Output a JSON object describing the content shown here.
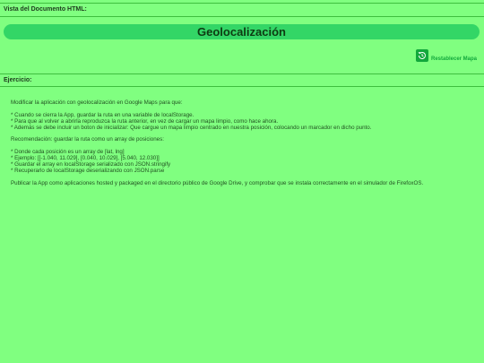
{
  "header": {
    "doc_view_label": "Vista del Documento HTML:"
  },
  "title": "Geolocalización",
  "reset_button": {
    "label": "Restablecer Mapa",
    "icon": "restore-history-icon"
  },
  "exercise": {
    "label": "Ejercicio:",
    "intro": "Modificar la aplicación con geolocalización en Google Maps para que:",
    "requirements": [
      "* Cuando se cierra la App, guardar la ruta en una variable de localStorage.",
      "* Para que al volver a abrirla reproduzca la ruta anterior, en vez de cargar un mapa limpio, como hace ahora.",
      "* Además se debe incluir un boton de inicializar: Que cargue un mapa limpio centrado en nuestra posición, colocando un marcador en dicho punto."
    ],
    "recommendation": "Recomendación: guardar la ruta como un array de posiciones:",
    "tips": [
      "* Donde cada posición es un array de [lat, lng]",
      "* Ejemplo: [[-1.040, 11.029], [0.040, 10.029], [5.040, 12.030]]",
      "* Guardar el array en localStorage serializado con JSON.stringify",
      "* Recuperarlo de localStorage deserializando con JSON.parse"
    ],
    "publish": "Publicar la App como aplicaciones hosted y packaged en el directorio público de Google Drive, y comprobar que se instala correctamente en el simulador de FirefoxOS."
  },
  "colors": {
    "background": "#80ff80",
    "title_bar": "#33d666",
    "button_accent": "#12a83c"
  }
}
